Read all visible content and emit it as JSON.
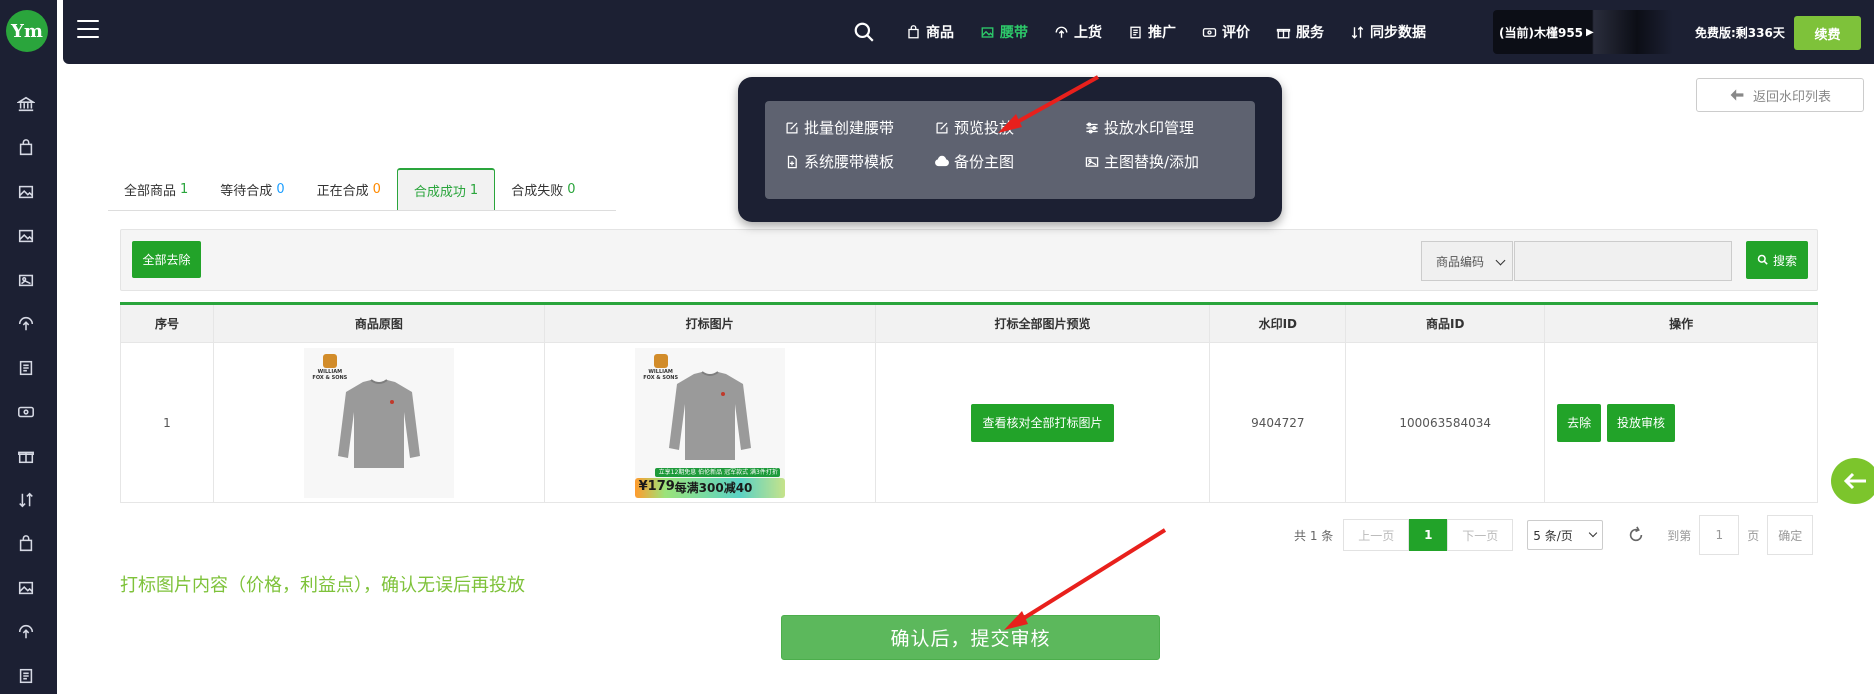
{
  "sidebar": {
    "logo_text": "Ym",
    "icons": [
      "bank-icon",
      "bag-icon",
      "image-icon",
      "image-icon",
      "gallery-icon",
      "upload-icon",
      "doc-icon",
      "money-icon",
      "gift-icon",
      "sync-icon",
      "bag-icon",
      "image-icon",
      "upload-icon",
      "doc-icon"
    ]
  },
  "topbar": {
    "nav": [
      {
        "label": "商品",
        "icon": "bag-icon",
        "active": false
      },
      {
        "label": "腰带",
        "icon": "image-icon",
        "active": true
      },
      {
        "label": "上货",
        "icon": "upload-icon",
        "active": false
      },
      {
        "label": "推广",
        "icon": "doc-icon",
        "active": false
      },
      {
        "label": "评价",
        "icon": "money-icon",
        "active": false
      },
      {
        "label": "服务",
        "icon": "gift-icon",
        "active": false
      },
      {
        "label": "同步数据",
        "icon": "sync-icon",
        "active": false
      }
    ],
    "account": "(当前)木槿955",
    "trial": "免费版:剩336天",
    "renew": "续费"
  },
  "dropdown": {
    "items": [
      {
        "label": "批量创建腰带",
        "icon": "edit-icon"
      },
      {
        "label": "预览投放",
        "icon": "edit-icon"
      },
      {
        "label": "投放水印管理",
        "icon": "sliders-icon"
      },
      {
        "label": "系统腰带模板",
        "icon": "file-plus-icon"
      },
      {
        "label": "备份主图",
        "icon": "cloud-upload-icon"
      },
      {
        "label": "主图替换/添加",
        "icon": "image-icon"
      }
    ]
  },
  "back_button": "返回水印列表",
  "tabs": [
    {
      "label": "全部商品",
      "count": "1",
      "color": "green"
    },
    {
      "label": "等待合成",
      "count": "0",
      "color": "blue"
    },
    {
      "label": "正在合成",
      "count": "0",
      "color": "orange"
    },
    {
      "label": "合成成功",
      "count": "1",
      "color": "green",
      "active": true
    },
    {
      "label": "合成失败",
      "count": "0",
      "color": "green"
    }
  ],
  "toolbar": {
    "remove_all": "全部去除",
    "select_value": "商品编码",
    "search_placeholder": "",
    "search_button": "搜索"
  },
  "table": {
    "headers": [
      "序号",
      "商品原图",
      "打标图片",
      "打标全部图片预览",
      "水印ID",
      "商品ID",
      "操作"
    ],
    "rows": [
      {
        "index": "1",
        "preview_button": "查看核对全部打标图片",
        "watermark_id": "9404727",
        "product_id": "100063584034",
        "remove_button": "去除",
        "review_button": "投放审核",
        "brand_line1": "WILLIAM",
        "brand_line2": "FOX & SONS",
        "promo_top": "立享12期免息  伯伦新品  冠军款式  满3件打折",
        "promo_price": "¥179",
        "promo_text": "每满300减40"
      }
    ]
  },
  "pagination": {
    "total": "共 1 条",
    "prev": "上一页",
    "current": "1",
    "next": "下一页",
    "per_page": "5 条/页",
    "goto_label": "到第",
    "goto_value": "1",
    "page_unit": "页",
    "confirm": "确定"
  },
  "notice": "打标图片内容（价格，利益点），确认无误后再投放",
  "submit": "确认后，提交审核",
  "colors": {
    "primary_green": "#22a329",
    "nav_bg": "#1c2033",
    "accent_green": "#2dc96a",
    "notice_green": "#7ec23a"
  }
}
